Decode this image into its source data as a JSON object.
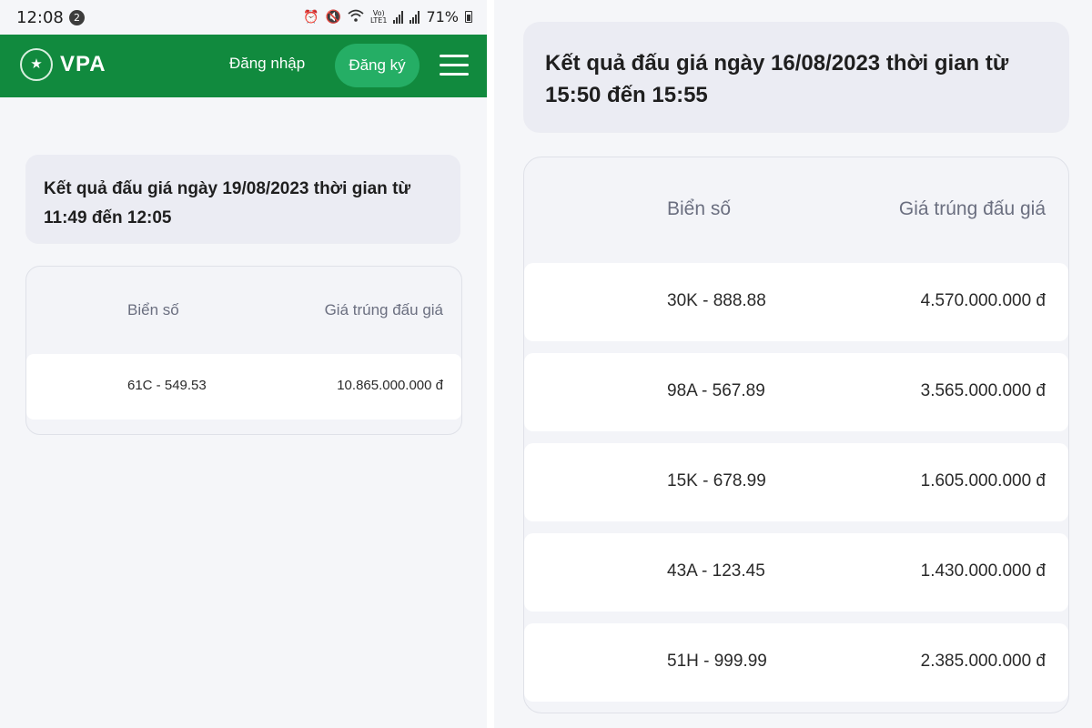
{
  "status_bar": {
    "time": "12:08",
    "notification_count": "2",
    "network_label_top": "Vo)",
    "network_label_bottom": "LTE1",
    "battery": "71%"
  },
  "header": {
    "logo_text": "VPA",
    "login_label": "Đăng nhập",
    "register_label": "Đăng ký",
    "brand_color": "#118a3e"
  },
  "left": {
    "title": "Kết quả đấu giá ngày 19/08/2023 thời gian từ 11:49 đến 12:05",
    "columns": [
      "Biển số",
      "Giá trúng đấu giá"
    ],
    "rows": [
      {
        "plate": "61C - 549.53",
        "price": "10.865.000.000 đ"
      }
    ]
  },
  "right": {
    "title": "Kết quả đấu giá ngày 16/08/2023 thời gian từ 15:50 đến 15:55",
    "columns": [
      "Biển số",
      "Giá trúng đấu giá"
    ],
    "rows": [
      {
        "plate": "30K - 888.88",
        "price": "4.570.000.000 đ"
      },
      {
        "plate": "98A - 567.89",
        "price": "3.565.000.000 đ"
      },
      {
        "plate": "15K - 678.99",
        "price": "1.605.000.000 đ"
      },
      {
        "plate": "43A - 123.45",
        "price": "1.430.000.000 đ"
      },
      {
        "plate": "51H - 999.99",
        "price": "2.385.000.000 đ"
      }
    ]
  }
}
